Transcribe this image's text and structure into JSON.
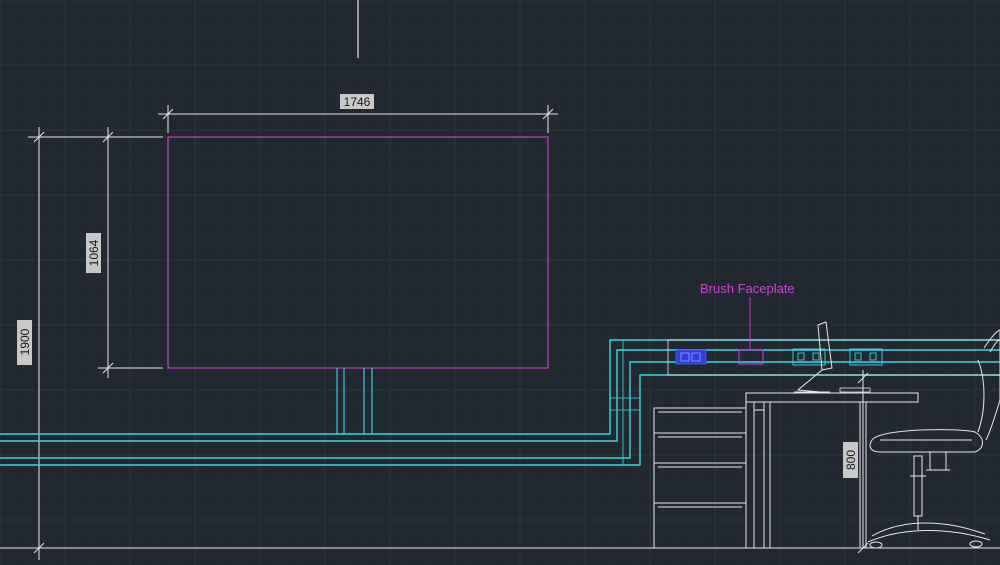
{
  "colors": {
    "background": "#212830",
    "grid_major": "#2c343e",
    "grid_minor": "#262d36",
    "white_line": "#e6e6e6",
    "cyan_line": "#37d7e4",
    "magenta_line": "#c040c8",
    "annotation_text": "#d23fd6",
    "dim_label_bg": "#c8c8c8",
    "blue_fill": "#2f3fd8"
  },
  "dimensions": {
    "screen_width": "1746",
    "screen_height": "1064",
    "overall_height": "1900",
    "desk_height": "800"
  },
  "annotations": {
    "faceplate_label": "Brush Faceplate"
  },
  "drawing_objects": {
    "screen": "magenta-rectangle",
    "stand": "double-post-stand",
    "cable_trays": "cyan-polylines",
    "cabinet": "drawer-pedestal",
    "desk": "desk-elevation",
    "chair": "office-chair",
    "monitor": "monitor-side",
    "faceplates": [
      "blue-data-port",
      "brush-faceplate",
      "socket-outlet-1",
      "socket-outlet-2"
    ]
  }
}
